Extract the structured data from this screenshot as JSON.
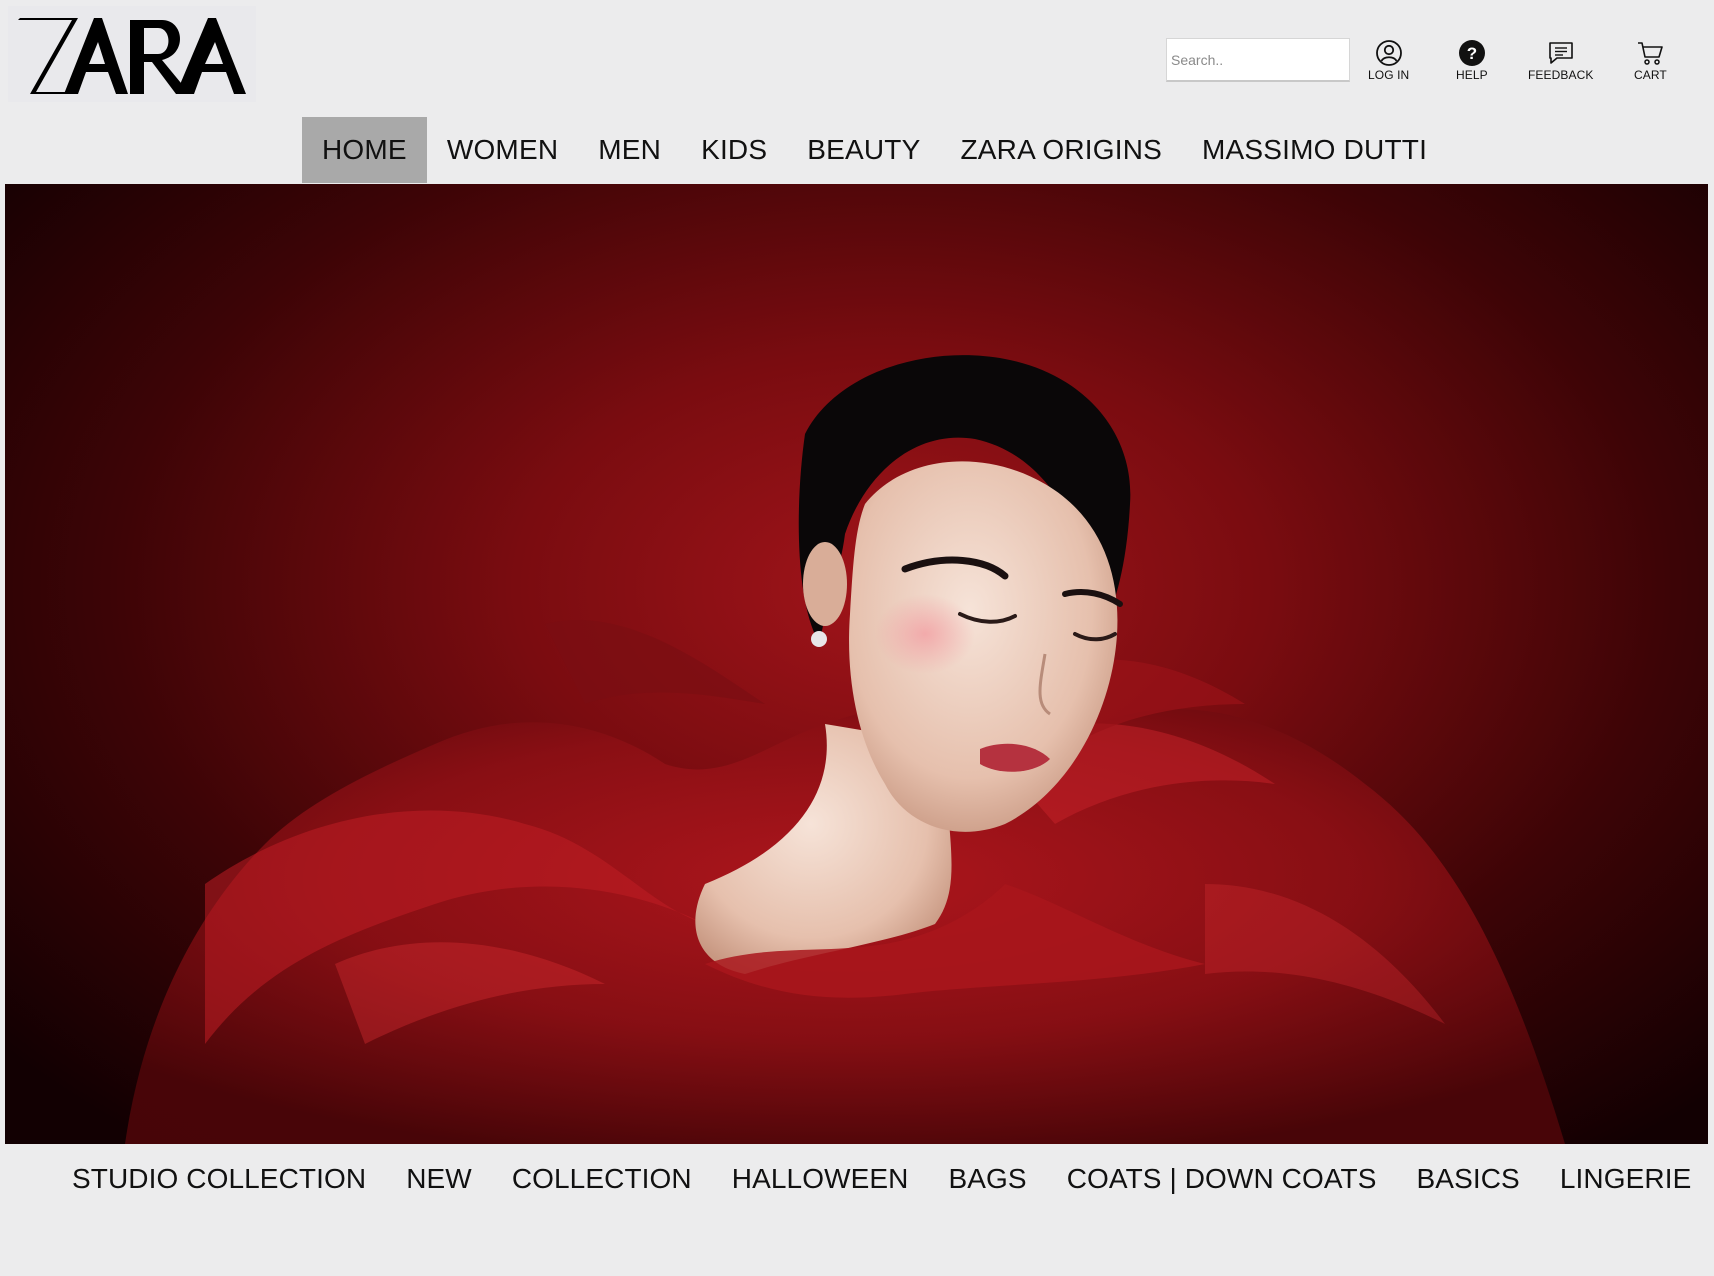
{
  "brand": {
    "logo_text": "ZARA"
  },
  "search": {
    "placeholder": "Search.."
  },
  "utilities": {
    "login": "LOG IN",
    "help": "HELP",
    "feedback": "FEEDBACK",
    "cart": "CART"
  },
  "main_nav": [
    {
      "label": "HOME",
      "active": true
    },
    {
      "label": "WOMEN"
    },
    {
      "label": "MEN"
    },
    {
      "label": "KIDS"
    },
    {
      "label": "BEAUTY"
    },
    {
      "label": "ZARA ORIGINS"
    },
    {
      "label": "MASSIMO DUTTI"
    }
  ],
  "hero": {
    "image_subject": "model-in-red-tulle-gown"
  },
  "sub_nav": [
    {
      "label": "STUDIO COLLECTION"
    },
    {
      "label": "NEW"
    },
    {
      "label": "COLLECTION"
    },
    {
      "label": "HALLOWEEN"
    },
    {
      "label": "BAGS"
    },
    {
      "label": "COATS | DOWN COATS"
    },
    {
      "label": "BASICS"
    },
    {
      "label": "LINGERIE"
    }
  ],
  "colors": {
    "background": "#ececed",
    "active_tab": "#a9a9a9",
    "hero_red": "#a1141a",
    "text": "#111111"
  }
}
